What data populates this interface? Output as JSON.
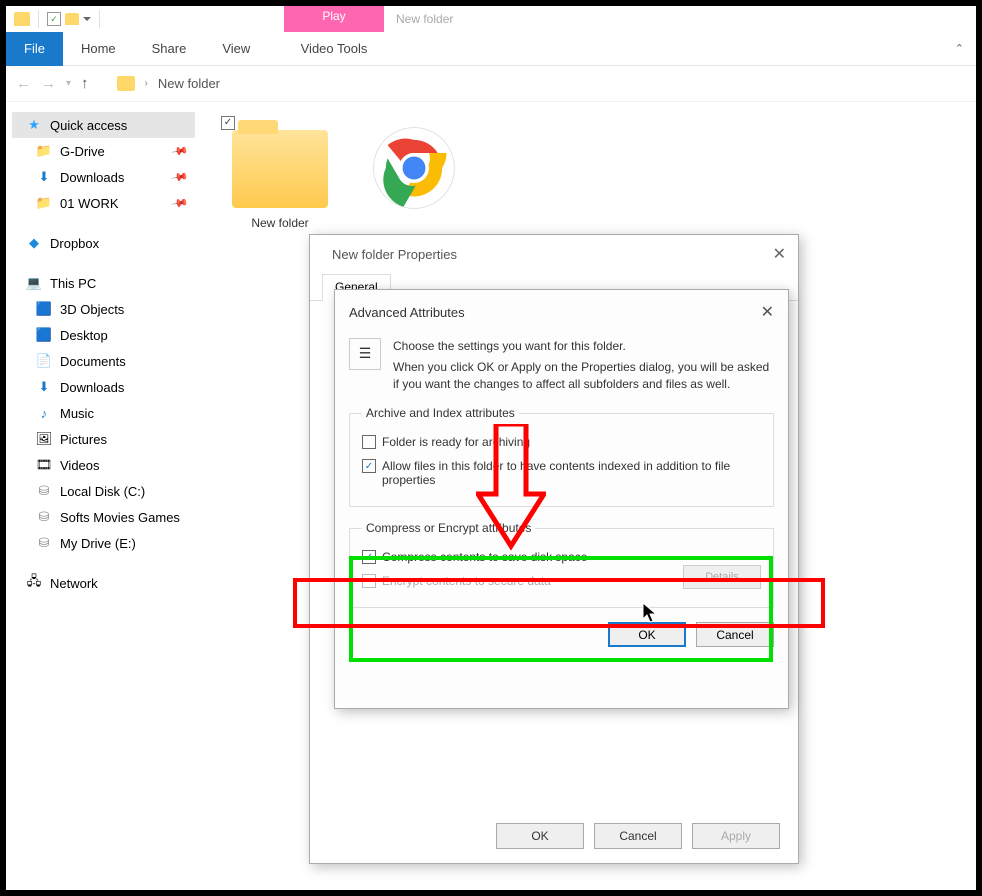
{
  "qat": {
    "contextual_tab": "Play",
    "window_title": "New folder"
  },
  "ribbon": {
    "file": "File",
    "tabs": [
      "Home",
      "Share",
      "View"
    ],
    "contextual": "Video Tools"
  },
  "address": {
    "location": "New folder"
  },
  "sidebar": {
    "quick_access": {
      "label": "Quick access"
    },
    "pinned": [
      {
        "label": "G-Drive"
      },
      {
        "label": "Downloads"
      },
      {
        "label": "01 WORK"
      }
    ],
    "dropbox": "Dropbox",
    "thispc": "This PC",
    "pc_items": [
      "3D Objects",
      "Desktop",
      "Documents",
      "Downloads",
      "Music",
      "Pictures",
      "Videos",
      "Local Disk (C:)",
      "Softs Movies Games",
      "My Drive (E:)"
    ],
    "network": "Network"
  },
  "content": {
    "folder_label": "New folder"
  },
  "properties_dialog": {
    "title": "New folder Properties",
    "tab_general": "General",
    "buttons": {
      "ok": "OK",
      "cancel": "Cancel",
      "apply": "Apply"
    }
  },
  "advanced_dialog": {
    "title": "Advanced Attributes",
    "desc_line1": "Choose the settings you want for this folder.",
    "desc_line2": "When you click OK or Apply on the Properties dialog, you will be asked if you want the changes to affect all subfolders and files as well.",
    "fieldset1": {
      "legend": "Archive and Index attributes",
      "cb1": "Folder is ready for archiving",
      "cb2": "Allow files in this folder to have contents indexed in addition to file properties"
    },
    "fieldset2": {
      "legend": "Compress or Encrypt attributes",
      "cb1": "Compress contents to save disk space",
      "cb2": "Encrypt contents to secure data",
      "details": "Details"
    },
    "buttons": {
      "ok": "OK",
      "cancel": "Cancel"
    }
  }
}
